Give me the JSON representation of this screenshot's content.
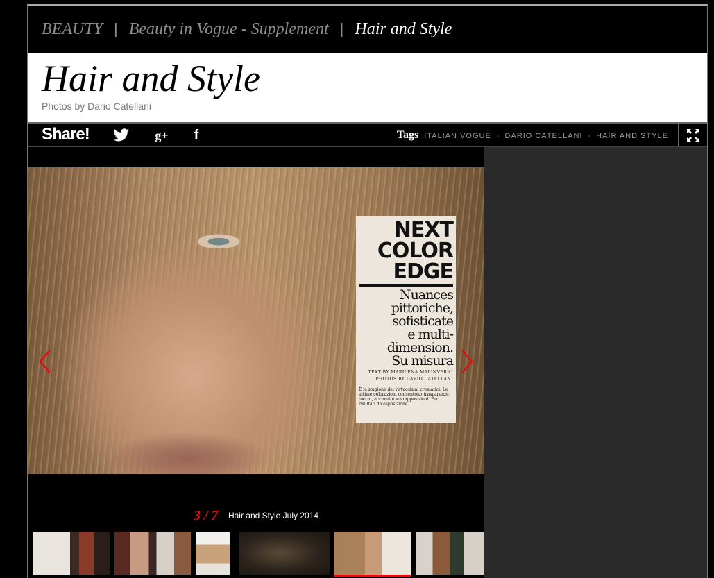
{
  "breadcrumb": {
    "items": [
      "BEAUTY",
      "Beauty in Vogue - Supplement"
    ],
    "current": "Hair and Style",
    "separator": "|"
  },
  "header": {
    "title": "Hair and Style",
    "byline": "Photos by Dario Catellani"
  },
  "share": {
    "label": "Share!",
    "icons": [
      "twitter-icon",
      "google-plus-icon",
      "facebook-icon"
    ],
    "gplus_text": "g+",
    "fb_text": "f"
  },
  "tags": {
    "label": "Tags",
    "items": [
      "ITALIAN VOGUE",
      "DARIO CATELLANI",
      "HAIR AND STYLE"
    ],
    "separator": "-"
  },
  "magazine": {
    "headline": [
      "NEXT",
      "COLOR",
      "EDGE"
    ],
    "subhead": [
      "Nuances",
      "pittoriche,",
      "sofisticate",
      "e multi-",
      "dimension.",
      "Su misura"
    ],
    "credits": [
      "TEXT BY MARILENA MALINVERNI",
      "PHOTOS BY DARIO CATELLANI"
    ],
    "body": "È la stagione dei virtuosismi cromatici. Le ultime colorazioni consentono trasparenze, tocchi, accenni e sovrapposizioni. Per risultati da esposizione"
  },
  "gallery": {
    "counter": "3 / 7",
    "caption": "Hair and Style July 2014",
    "active_index": 4
  },
  "colors": {
    "accent": "#e01010",
    "panel": "#2a2a2a",
    "muted": "#8c8c8c"
  }
}
